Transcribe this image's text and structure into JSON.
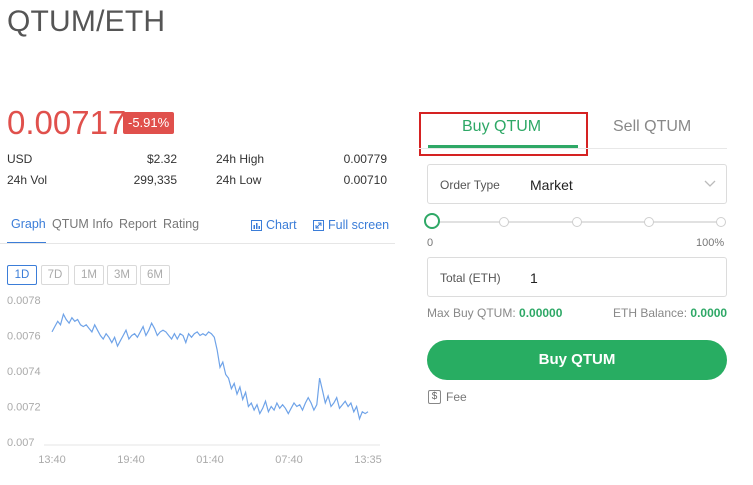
{
  "pair": "QTUM/ETH",
  "price": "0.00717",
  "change": "-5.91%",
  "stats": {
    "usd_label": "USD",
    "usd_value": "$2.32",
    "high_label": "24h High",
    "high_value": "0.00779",
    "vol_label": "24h Vol",
    "vol_value": "299,335",
    "low_label": "24h Low",
    "low_value": "0.00710"
  },
  "tabs": [
    "Graph",
    "QTUM Info",
    "Report",
    "Rating"
  ],
  "tools": {
    "chart": "Chart",
    "fullscreen": "Full screen"
  },
  "ranges": [
    "1D",
    "7D",
    "1M",
    "3M",
    "6M"
  ],
  "chart_data": {
    "type": "line",
    "title": "",
    "xlabel": "",
    "ylabel": "",
    "ylim": [
      0.007,
      0.0078
    ],
    "yticks": [
      "0.0078",
      "0.0076",
      "0.0074",
      "0.0072",
      "0.007"
    ],
    "xticks": [
      "13:40",
      "19:40",
      "01:40",
      "07:40",
      "13:35"
    ],
    "line_color": "#6fa3e8",
    "series": [
      {
        "values": [
          0.00762,
          0.00765,
          0.00768,
          0.00766,
          0.00772,
          0.00769,
          0.00767,
          0.0077,
          0.00768,
          0.00769,
          0.00766,
          0.00765,
          0.00766,
          0.00764,
          0.00762,
          0.00766,
          0.00763,
          0.0076,
          0.00758,
          0.00761,
          0.00759,
          0.00756,
          0.00759,
          0.00754,
          0.00757,
          0.0076,
          0.00763,
          0.00758,
          0.0076,
          0.00761,
          0.00759,
          0.00762,
          0.00765,
          0.0076,
          0.00763,
          0.00767,
          0.00764,
          0.0076,
          0.00762,
          0.00763,
          0.00762,
          0.0076,
          0.00758,
          0.00761,
          0.00758,
          0.00761,
          0.0076,
          0.00756,
          0.00761,
          0.00759,
          0.00761,
          0.00762,
          0.0076,
          0.00761,
          0.0076,
          0.00762,
          0.00761,
          0.00759,
          0.00752,
          0.00742,
          0.00745,
          0.00738,
          0.00736,
          0.0073,
          0.00733,
          0.00727,
          0.00731,
          0.00724,
          0.00728,
          0.0072,
          0.00722,
          0.00718,
          0.00721,
          0.00716,
          0.00719,
          0.00723,
          0.00717,
          0.0072,
          0.00718,
          0.00722,
          0.00719,
          0.00721,
          0.00719,
          0.00716,
          0.00719,
          0.00722,
          0.0072,
          0.00721,
          0.00718,
          0.00722,
          0.00725,
          0.00722,
          0.00718,
          0.00721,
          0.00736,
          0.00729,
          0.00722,
          0.00726,
          0.0072,
          0.00722,
          0.00725,
          0.00719,
          0.00721,
          0.00723,
          0.0072,
          0.00722,
          0.00717,
          0.0072,
          0.00713,
          0.00717,
          0.00716,
          0.00717
        ]
      }
    ],
    "grid": false
  },
  "trade": {
    "buy_tab": "Buy QTUM",
    "sell_tab": "Sell QTUM",
    "order_type_label": "Order Type",
    "order_type_value": "Market",
    "slider_min": "0",
    "slider_max": "100%",
    "slider_value_percent": 0,
    "total_label": "Total (ETH)",
    "total_value": "1",
    "max_buy_label": "Max Buy QTUM:",
    "max_buy_value": "0.00000",
    "balance_label": "ETH Balance:",
    "balance_value": "0.0000",
    "buy_button": "Buy QTUM",
    "fee_label": "Fee",
    "fee_icon": "$"
  }
}
